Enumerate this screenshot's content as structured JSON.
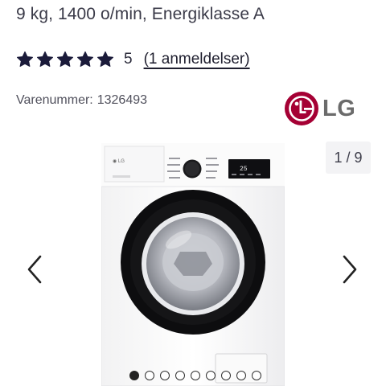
{
  "product": {
    "subtitle": "9 kg, 1400 o/min, Energiklasse A",
    "rating": {
      "stars_filled": 5,
      "stars_total": 5,
      "value": "5",
      "reviews_link": "(1 anmeldelser)",
      "star_color": "#1b1b3a"
    },
    "sku_label": "Varenummer:",
    "sku_value": "1326493",
    "brand": {
      "logo_text": "LG",
      "logo_icon": "lg-logo-icon",
      "brand_color": "#a50034"
    }
  },
  "gallery": {
    "current": "1",
    "separator": "/",
    "total": "9",
    "prev_icon": "chevron-left-icon",
    "next_icon": "chevron-right-icon",
    "dots_count": 9,
    "active_dot": 0,
    "machine_display": "25"
  }
}
